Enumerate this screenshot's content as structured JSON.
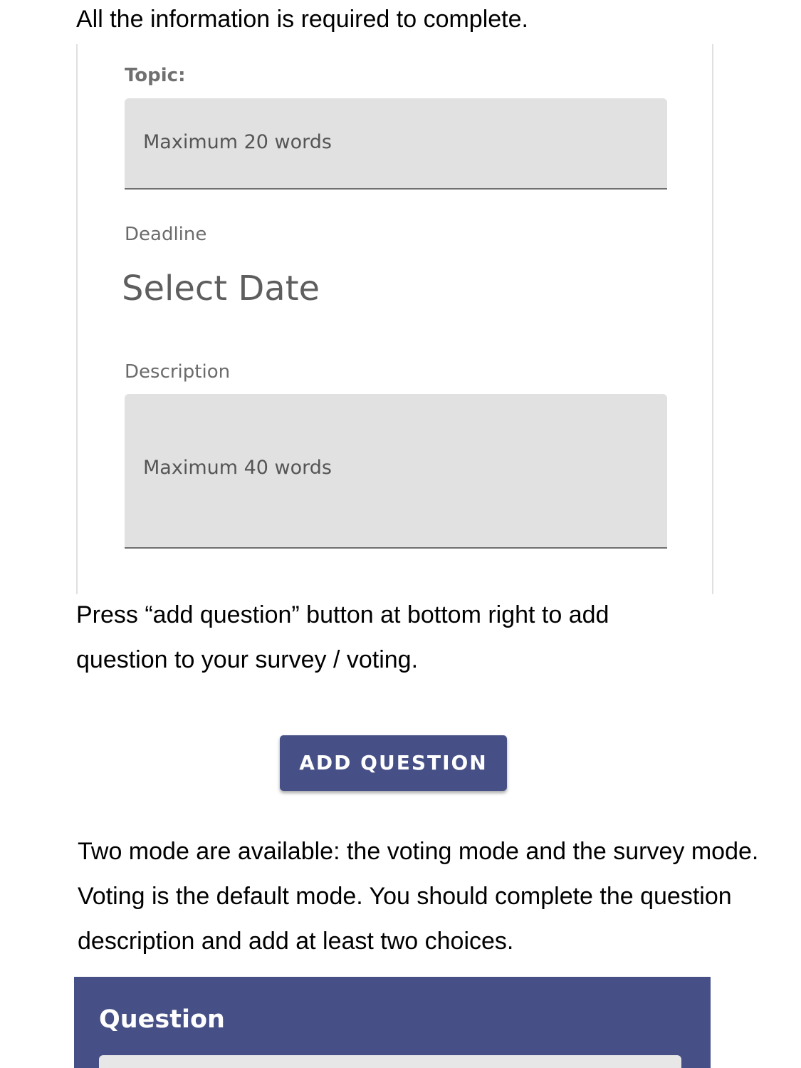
{
  "instructions": {
    "intro": "All the information is required to complete.",
    "add_question_help": "Press “add question” button at bottom right to add question to your survey / voting.",
    "modes_help": "Two mode are available: the voting mode and the survey mode. Voting is the default mode. You should complete the question description and add at least two choices."
  },
  "form": {
    "topic_label": "Topic:",
    "topic_placeholder": "Maximum 20 words",
    "deadline_label": "Deadline",
    "deadline_value": "Select Date",
    "description_label": "Description",
    "description_placeholder": "Maximum 40 words"
  },
  "add_question_button": "ADD QUESTION",
  "question_panel": {
    "title": "Question"
  },
  "colors": {
    "accent": "#465086",
    "input_fill": "#e1e1e1"
  }
}
